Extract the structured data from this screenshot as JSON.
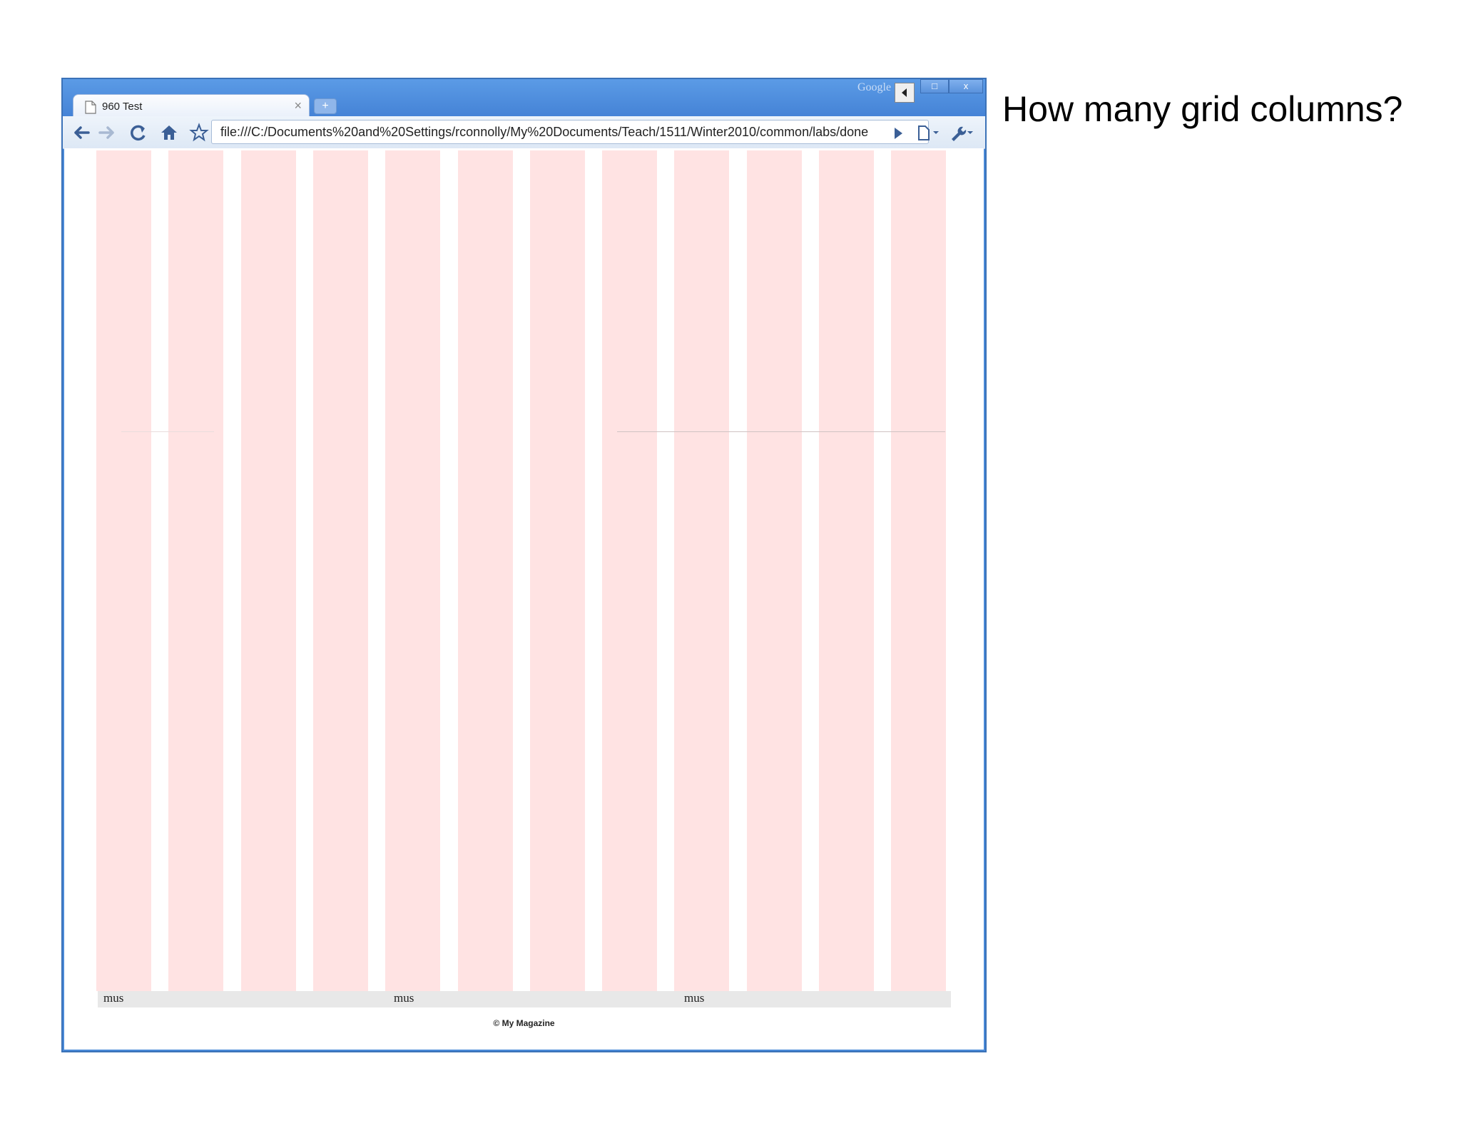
{
  "browser": {
    "tab_title": "960 Test",
    "tab_close": "×",
    "new_tab": "+",
    "search_engine": "Google",
    "url": "file:///C:/Documents%20and%20Settings/rconnolly/My%20Documents/Teach/1511/Winter2010/common/labs/done",
    "window_controls": {
      "restore": "□",
      "close": "x"
    }
  },
  "icons": [
    "page-icon",
    "back-arrow-icon",
    "forward-arrow-icon",
    "reload-icon",
    "home-icon",
    "star-icon",
    "go-arrow-icon",
    "page-menu-icon",
    "wrench-icon",
    "chevron-down-icon"
  ],
  "grid": {
    "column_count": 12,
    "column_color": "#ffe3e3"
  },
  "footer": {
    "labels": [
      "mus",
      "mus",
      "mus"
    ],
    "copyright": "© My Magazine"
  },
  "question": "How many grid columns?"
}
